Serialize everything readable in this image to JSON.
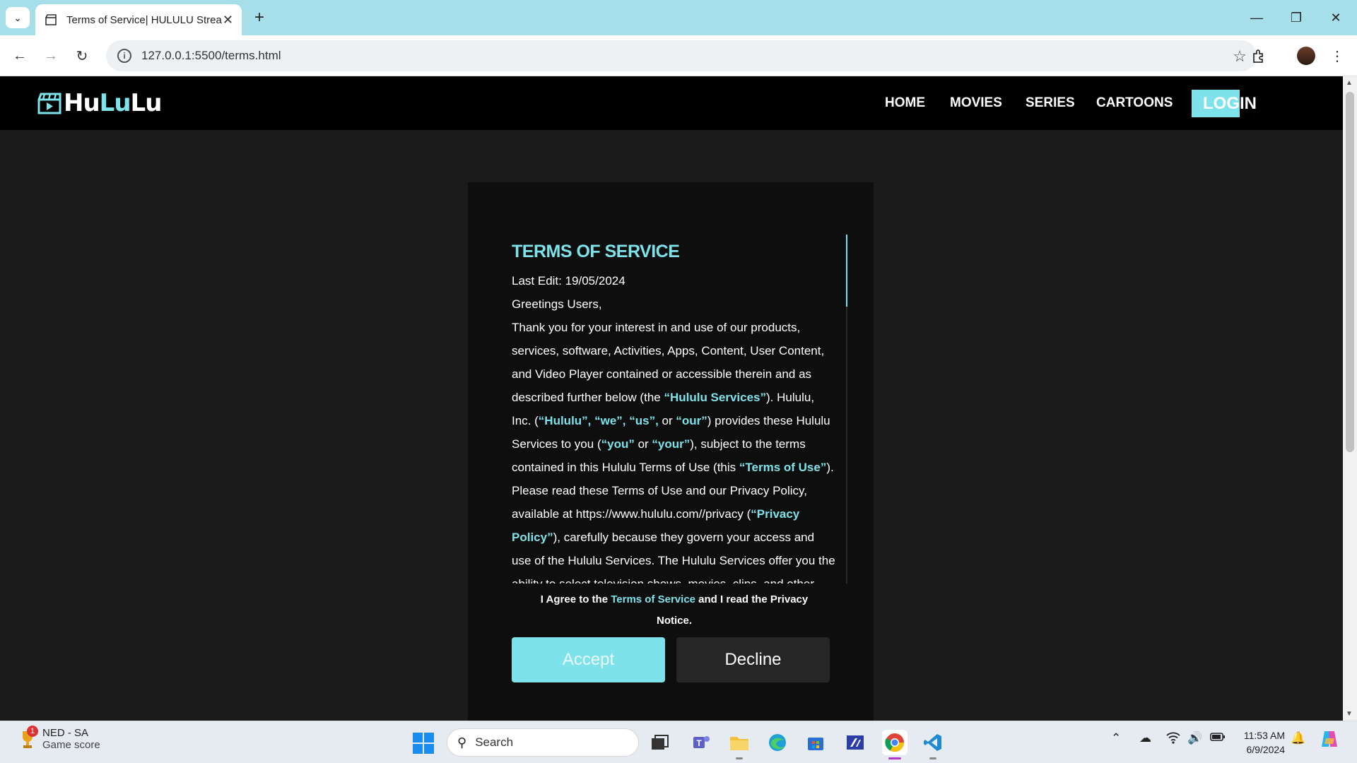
{
  "browser": {
    "tab_title": "Terms of Service| HULULU Strea",
    "url": "127.0.0.1:5500/terms.html"
  },
  "site": {
    "logo_part1": "Hu",
    "logo_part2": "Lu",
    "logo_part3": "Lu",
    "nav": {
      "home": "HOME",
      "movies": "MOVIES",
      "series": "SERIES",
      "cartoons": "CARTOONS",
      "login": "LOGIN"
    }
  },
  "terms": {
    "title": "TERMS OF SERVICE",
    "last_edit": "Last Edit: 19/05/2024",
    "greeting": "Greetings Users,",
    "body": {
      "p1": "Thank you for your interest in and use of our products, services, software, Activities, Apps, Content, User Content, and Video Player contained or accessible therein and as described further below (the ",
      "hl1": "“Hululu Services”",
      "p2": "). Hululu, Inc. (",
      "hl2": "“Hululu”, “we”, “us”,",
      "p3": " or ",
      "hl3": "“our”",
      "p4": ") provides these Hululu Services to you (",
      "hl4": "“you”",
      "p5": " or ",
      "hl5": "“your”",
      "p6": "), subject to the terms contained in this Hululu Terms of Use (this ",
      "hl6": "“Terms of Use”",
      "p7": "). Please read these Terms of Use and our Privacy Policy, available at https://www.hululu.com//privacy (",
      "hl7": "“Privacy Policy”",
      "p8": "), carefully because they govern your access and use of the Hululu Services. The Hululu Services offer you the ability to select television shows, movies, clips, and other"
    },
    "agree_prefix": "I Agree to the ",
    "agree_link": "Terms of Service",
    "agree_suffix": " and I read the Privacy Notice.",
    "accept_label": "Accept",
    "decline_label": "Decline"
  },
  "taskbar": {
    "widget_title": "NED - SA",
    "widget_sub": "Game score",
    "widget_badge": "1",
    "search_placeholder": "Search",
    "time": "11:53 AM",
    "date": "6/9/2024"
  },
  "colors": {
    "accent": "#7ee2ea",
    "header_bg": "#000000",
    "page_bg": "#1b1b1b",
    "card_bg": "#0e0e0e"
  }
}
